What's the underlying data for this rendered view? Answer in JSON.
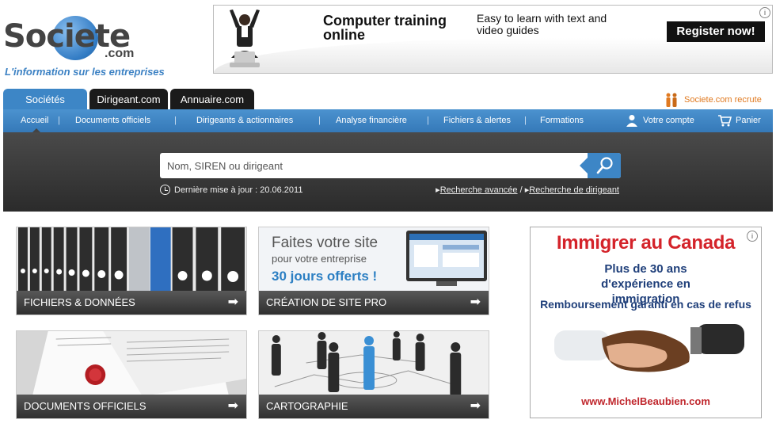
{
  "logo": {
    "word": "Societe",
    "dotcom": ".com",
    "tagline": "L'information sur les entreprises"
  },
  "top_ad": {
    "headline": "Computer training online",
    "subtext": "Easy to learn with text and video guides",
    "cta": "Register now!",
    "info": "i"
  },
  "tabs": [
    {
      "label": "Sociétés",
      "active": true
    },
    {
      "label": "Dirigeant.com",
      "active": false
    },
    {
      "label": "Annuaire.com",
      "active": false
    }
  ],
  "recrute": "Societe.com recrute",
  "nav": {
    "items": [
      "Accueil",
      "Documents officiels",
      "Dirigeants & actionnaires",
      "Analyse financière",
      "Fichiers & alertes",
      "Formations"
    ],
    "separator": "|",
    "account": "Votre compte",
    "cart": "Panier"
  },
  "search": {
    "placeholder": "Nom, SIREN ou dirigeant",
    "update_text": "Dernière mise à jour : 20.06.2011",
    "advanced": "Recherche avancée",
    "dirigeant": "Recherche de dirigeant",
    "slash": "/"
  },
  "tiles": {
    "fichiers": "FICHIERS & DONNÉES",
    "creation": "CRÉATION DE SITE PRO",
    "creation_art": {
      "line1": "Faites votre site",
      "line2": "pour votre entreprise",
      "line3": "30 jours offerts !"
    },
    "documents": "DOCUMENTS OFFICIELS",
    "cartographie": "CARTOGRAPHIE",
    "arrow": "➡"
  },
  "right_ad": {
    "title": "Immigrer au Canada",
    "line2": "Plus de 30 ans d'expérience en immigration",
    "line3": "Remboursement garanti en cas de refus",
    "url": "www.MichelBeaubien.com",
    "info": "i"
  },
  "colors": {
    "accent": "#3d86c6",
    "ad_red": "#d4232a",
    "ad_blue": "#1f3f7a",
    "recrute": "#e07a21"
  }
}
